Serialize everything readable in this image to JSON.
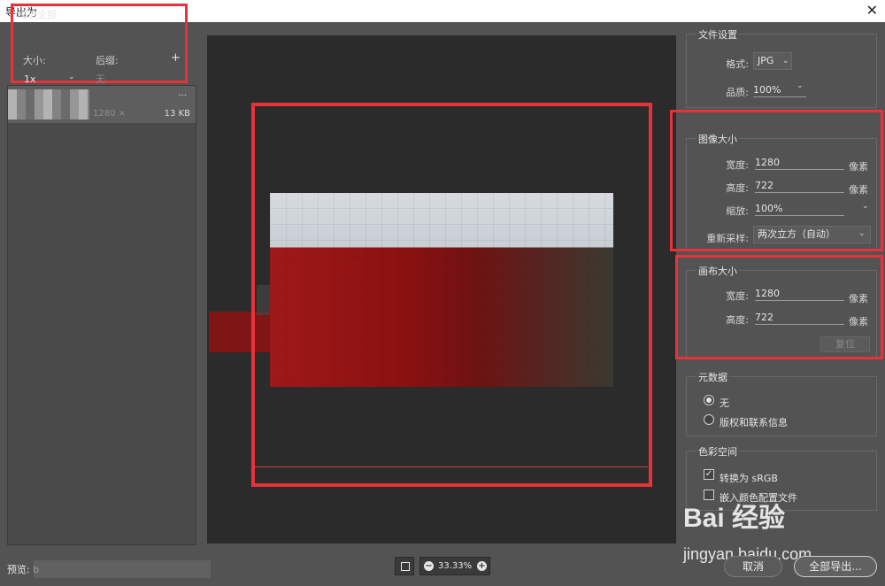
{
  "window": {
    "title": "导出为",
    "close_glyph": "✕"
  },
  "scale_all": {
    "title": "缩放全部",
    "size_label": "大小:",
    "suffix_label": "后缀:",
    "size_value": "1x",
    "suffix_placeholder": "无",
    "add_glyph": "+"
  },
  "list": {
    "row": {
      "dims": "1280 ×",
      "size": "13 KB",
      "more_glyph": "···"
    }
  },
  "zoom": {
    "value": "33.33%",
    "minus": "−",
    "plus": "+"
  },
  "footer": {
    "preview_label": "预览: b"
  },
  "file_settings": {
    "title": "文件设置",
    "format_label": "格式:",
    "format_value": "JPG",
    "quality_label": "品质:",
    "quality_value": "100%"
  },
  "image_size": {
    "title": "图像大小",
    "width_label": "宽度:",
    "width_value": "1280",
    "height_label": "高度:",
    "height_value": "722",
    "scale_label": "缩放:",
    "scale_value": "100%",
    "resample_label": "重新采样:",
    "resample_value": "两次立方（自动）",
    "unit": "像素"
  },
  "canvas_size": {
    "title": "画布大小",
    "width_label": "宽度:",
    "width_value": "1280",
    "height_label": "高度:",
    "height_value": "722",
    "unit": "像素",
    "reset_label": "复位"
  },
  "metadata": {
    "title": "元数据",
    "option_none": "无",
    "option_copyright": "版权和联系信息"
  },
  "color_space": {
    "title": "色彩空间",
    "convert_label": "转换为 sRGB",
    "embed_label": "嵌入颜色配置文件"
  },
  "buttons": {
    "cancel": "取消",
    "export_all": "全部导出..."
  },
  "watermark": {
    "brand": "Bai 经验",
    "url": "jingyan.baidu.com"
  },
  "colors": {
    "highlight": "#e8323a",
    "panel": "#535353",
    "preview_bg": "#2b2b2b"
  }
}
